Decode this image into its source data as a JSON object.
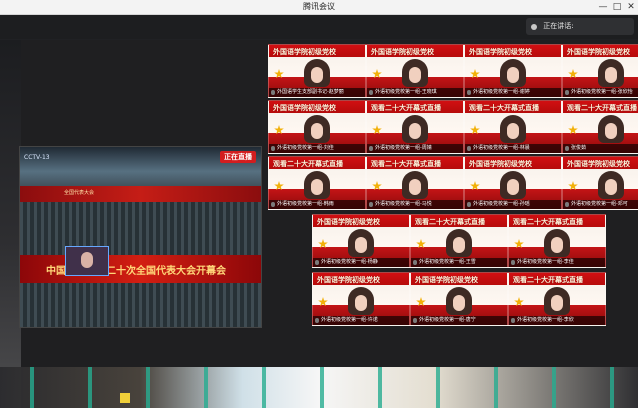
{
  "window": {
    "title": "腾讯会议",
    "controls": [
      "—",
      "□",
      "✕"
    ]
  },
  "speaking": {
    "label": "正在讲话:",
    "name": ""
  },
  "shared_screen": {
    "logo": "CCTV-13",
    "live_badge": "正在直播",
    "banner": "全国代表大会",
    "caption": "中国共产党第二十次全国代表大会开幕会"
  },
  "tiles": [
    {
      "text": "外国语学院初级党校",
      "name": "外国语学生支部副书记-赵梦丽"
    },
    {
      "text": "外国语学院初级党校",
      "name": "外语初级党校第一组-王晓琪"
    },
    {
      "text": "外国语学院初级党校",
      "name": "外语初级党校第一组-谢婷"
    },
    {
      "text": "外国语学院初级党校",
      "name": "外语初级党校第一组-张欣怡"
    },
    {
      "text": "外国语学院初级党校",
      "name": "外语初级党校第一组-刘佳"
    },
    {
      "text": "观看二十大开幕式直播",
      "name": "外语初级党校第一组-周婧"
    },
    {
      "text": "观看二十大开幕式直播",
      "name": "外语初级党校第一组-林晨"
    },
    {
      "text": "观看二十大开幕式直播",
      "name": "张俊茹"
    },
    {
      "text": "观看二十大开幕式直播",
      "name": "外语初级党校第一组-韩雨"
    },
    {
      "text": "观看二十大开幕式直播",
      "name": "外语初级党校第一组-马悦"
    },
    {
      "text": "外国语学院初级党校",
      "name": "外语初级党校第一组-孙瑶"
    },
    {
      "text": "外国语学院初级党校",
      "name": "外语初级党校第一组-邓可"
    },
    {
      "text": "外国语学院初级党校",
      "name": "外语初级党校第一组-杨静"
    },
    {
      "text": "观看二十大开幕式直播",
      "name": "外语初级党校第一组-王雪"
    },
    {
      "text": "观看二十大开幕式直播",
      "name": "外语初级党校第一组-李佳"
    },
    {
      "text": "外国语学院初级党校",
      "name": "外语初级党校第一组-许诺"
    },
    {
      "text": "外国语学院初级党校",
      "name": "外语初级党校第一组-唐宁"
    },
    {
      "text": "观看二十大开幕式直播",
      "name": "外语初级党校第一组-李欣"
    }
  ]
}
